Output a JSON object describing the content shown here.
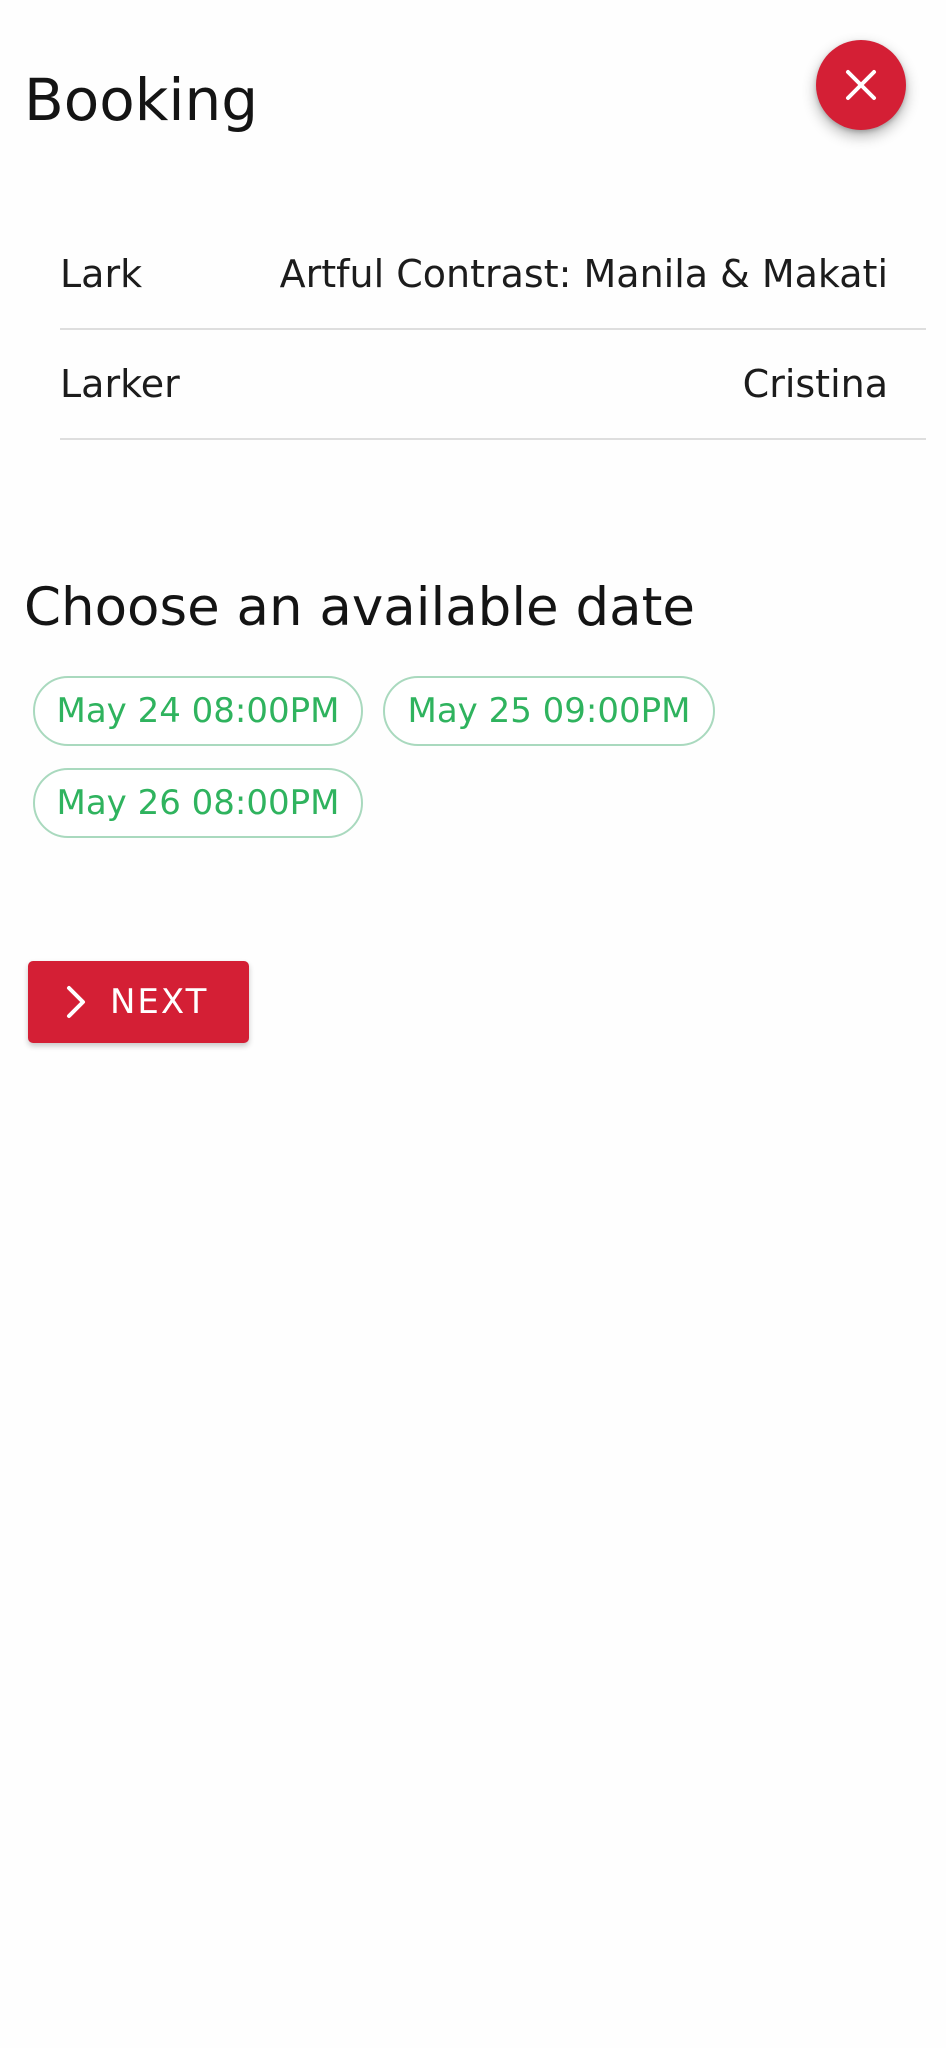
{
  "header": {
    "title": "Booking",
    "close_icon": "close-icon"
  },
  "details": [
    {
      "label": "Lark",
      "value": "Artful Contrast: Manila & Makati"
    },
    {
      "label": "Larker",
      "value": "Cristina"
    }
  ],
  "dates": {
    "heading": "Choose an available date",
    "options": [
      "May 24 08:00PM",
      "May 25 09:00PM",
      "May 26 08:00PM"
    ]
  },
  "next_button": {
    "label": "NEXT",
    "icon": "chevron-right-icon"
  },
  "colors": {
    "accent": "#d41f35",
    "chip_text": "#2fb35e",
    "chip_border": "#a9d9be"
  }
}
